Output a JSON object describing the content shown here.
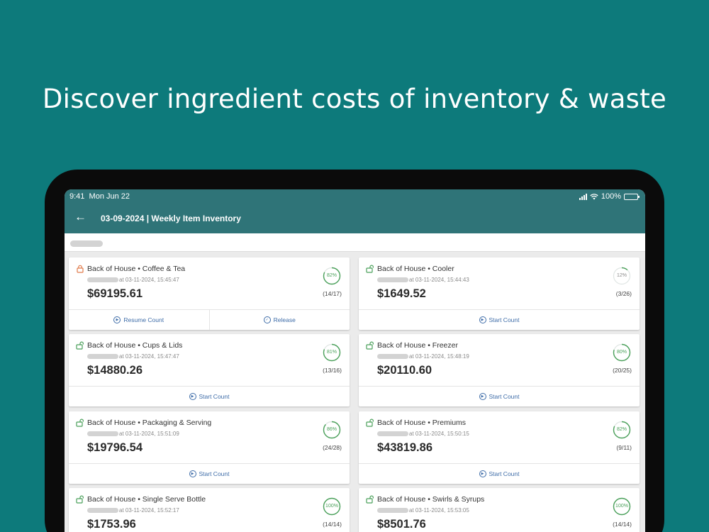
{
  "headline": "Discover ingredient costs of inventory & waste",
  "status_bar": {
    "time": "9:41",
    "date": "Mon Jun 22",
    "battery": "100%"
  },
  "app_bar": {
    "title": "03-09-2024 | Weekly Item Inventory"
  },
  "colors": {
    "background": "#0d7a7b",
    "header": "#2f7478",
    "accent": "#3e6ca8",
    "progress": "#4aa05a",
    "locked": "#e07a4a"
  },
  "cards": [
    {
      "name": "Back of House • Coffee & Tea",
      "timestamp": "at 03-11-2024, 15:45:47",
      "amount": "$69195.61",
      "percent": "82%",
      "progress": 0.82,
      "count": "(14/17)",
      "locked": true,
      "actions": [
        "Resume Count",
        "Release"
      ]
    },
    {
      "name": "Back of House • Cooler",
      "timestamp": "at 03-11-2024, 15:44:43",
      "amount": "$1649.52",
      "percent": "12%",
      "progress": 0.12,
      "count": "(3/26)",
      "locked": false,
      "actions": [
        "Start Count"
      ]
    },
    {
      "name": "Back of House • Cups & Lids",
      "timestamp": "at 03-11-2024, 15:47:47",
      "amount": "$14880.26",
      "percent": "81%",
      "progress": 0.81,
      "count": "(13/16)",
      "locked": false,
      "actions": [
        "Start Count"
      ]
    },
    {
      "name": "Back of House • Freezer",
      "timestamp": "at 03-11-2024, 15:48:19",
      "amount": "$20110.60",
      "percent": "80%",
      "progress": 0.8,
      "count": "(20/25)",
      "locked": false,
      "actions": [
        "Start Count"
      ]
    },
    {
      "name": "Back of House • Packaging & Serving",
      "timestamp": "at 03-11-2024, 15:51:09",
      "amount": "$19796.54",
      "percent": "86%",
      "progress": 0.86,
      "count": "(24/28)",
      "locked": false,
      "actions": [
        "Start Count"
      ]
    },
    {
      "name": "Back of House • Premiums",
      "timestamp": "at 03-11-2024, 15:50:15",
      "amount": "$43819.86",
      "percent": "82%",
      "progress": 0.82,
      "count": "(9/11)",
      "locked": false,
      "actions": [
        "Start Count"
      ]
    },
    {
      "name": "Back of House • Single Serve Bottle",
      "timestamp": "at 03-11-2024, 15:52:17",
      "amount": "$1753.96",
      "percent": "100%",
      "progress": 1.0,
      "count": "(14/14)",
      "locked": false,
      "actions": []
    },
    {
      "name": "Back of House • Swirls & Syrups",
      "timestamp": "at 03-11-2024, 15:53:05",
      "amount": "$8501.76",
      "percent": "100%",
      "progress": 1.0,
      "count": "(14/14)",
      "locked": false,
      "actions": []
    }
  ]
}
